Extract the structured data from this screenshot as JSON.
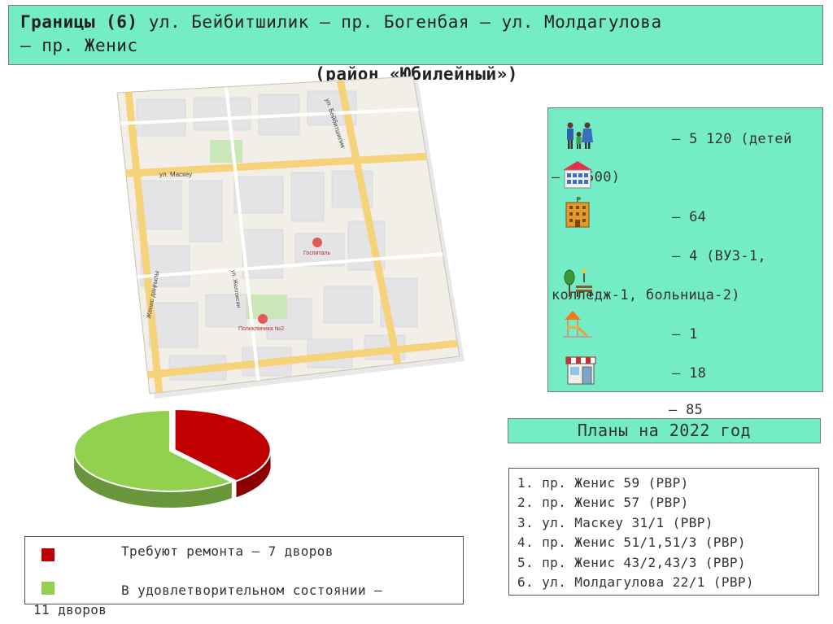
{
  "title": {
    "bold_part": "Границы (6)",
    "line1_rest": " ул. Бейбитшилик – пр. Богенбая – ул. Молдагулова",
    "line2": "– пр. Женис",
    "subtitle": "(район «Юбилейный»)"
  },
  "map": {
    "street_maskeu": "ул. Маскеу",
    "street_beibitshilik": "ул. Бейбитшилик",
    "street_zhenis": "Женис даңғылы",
    "street_zheltoksan": "ул. Желтоксан",
    "hospital": "Госпиталь",
    "polyclinic": "Поликлиника №2"
  },
  "stats": {
    "population_line1": "– 5 120 (детей",
    "population_line2": "– 1 500)",
    "houses": "– 64",
    "institutions_line1": "– 4 (ВУЗ-1,",
    "institutions_line2": "колледж-1, больница-2)",
    "playgrounds": "– 1",
    "shops": "– 18",
    "overflow": "– 85"
  },
  "plans": {
    "heading": "Планы на 2022 год",
    "items": [
      "1. пр. Женис 59 (РВР)",
      "2. пр. Женис 57 (РВР)",
      "3. ул. Маскеу 31/1 (РВР)",
      "4. пр. Женис 51/1,51/3 (РВР)",
      "5. пр. Женис 43/2,43/3 (РВР)",
      "6. ул. Молдагулова 22/1 (РВР)"
    ]
  },
  "legend": {
    "repair_label": "Требуют ремонта – 7 дворов",
    "ok_label_line1": "В удовлетворительном состоянии –",
    "ok_label_line2": "11 дворов",
    "repair_color": "#c00000",
    "ok_color": "#92d050"
  },
  "chart_data": {
    "type": "pie",
    "categories": [
      "Требуют ремонта",
      "В удовлетворительном состоянии"
    ],
    "values": [
      7,
      11
    ],
    "colors": [
      "#c00000",
      "#92d050"
    ]
  }
}
